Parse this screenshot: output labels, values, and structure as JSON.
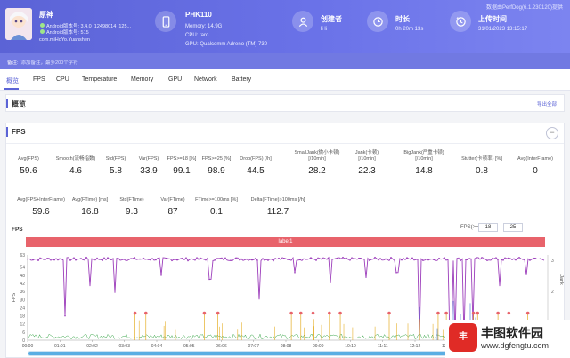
{
  "header": {
    "note": "数据由PerfDog(6.1.230120)提供",
    "app": {
      "name": "原神",
      "android_version": "Android版本号: 3.4.0_12498014_125...",
      "android_build": "Android版本号: 515",
      "package": "com.miHoYo.Yuanshen"
    },
    "device": {
      "name": "PHK110",
      "memory": "Memory: 14.9G",
      "cpu": "CPU: taro",
      "gpu": "GPU: Qualcomm Adreno (TM) 730"
    },
    "creator": {
      "label": "创建者",
      "value": "li li"
    },
    "duration": {
      "label": "时长",
      "value": "0h 20m 13s"
    },
    "upload": {
      "label": "上传时间",
      "value": "31/01/2023 13:15:17"
    }
  },
  "subbar": {
    "label": "备注:",
    "placeholder": "添加备注，最多200个字符"
  },
  "tabs": [
    "概览",
    "FPS",
    "CPU",
    "Temperature",
    "Memory",
    "GPU",
    "Network",
    "Battery"
  ],
  "overview": {
    "title": "概览",
    "export": "导出全部"
  },
  "fps": {
    "title": "FPS",
    "collapse": "−",
    "metrics_row1": [
      {
        "label": "Avg(FPS)",
        "value": "59.6"
      },
      {
        "label": "Smooth(流畅指数)",
        "value": "4.6"
      },
      {
        "label": "Std(FPS)",
        "value": "5.8"
      },
      {
        "label": "Var(FPS)",
        "value": "33.9"
      },
      {
        "label": "FPS>=18 [%]",
        "value": "99.1"
      },
      {
        "label": "FPS>=25 [%]",
        "value": "98.9"
      },
      {
        "label": "Drop(FPS) [/h]",
        "value": "44.5"
      },
      {
        "label": "SmallJank(微小卡顿)\n[/10min]",
        "value": "28.2"
      },
      {
        "label": "Jank(卡顿)\n[/10min]",
        "value": "22.3"
      },
      {
        "label": "BigJank(严重卡顿)\n[/10min]",
        "value": "14.8"
      },
      {
        "label": "Stutter(卡顿率) [%]",
        "value": "0.8"
      },
      {
        "label": "Avg(InterFrame)",
        "value": "0"
      }
    ],
    "metrics_row2": [
      {
        "label": "Avg(FPS+InterFrame)",
        "value": "59.6"
      },
      {
        "label": "Avg(FTime) [ms]",
        "value": "16.8"
      },
      {
        "label": "Std(FTime)",
        "value": "9.3"
      },
      {
        "label": "Var(FTime)",
        "value": "87"
      },
      {
        "label": "FTime>=100ms [%]",
        "value": "0.1"
      },
      {
        "label": "Delta(FTime)>100ms [/h]",
        "value": "112.7"
      }
    ],
    "chart_title": "FPS",
    "threshold_label": "FPS(>=)",
    "threshold_values": [
      "18",
      "25"
    ],
    "band_label": "label1"
  },
  "chart_data": {
    "type": "line",
    "ylabel": "FPS",
    "y2label": "Jank",
    "yticks": [
      0,
      6,
      12,
      18,
      24,
      30,
      36,
      42,
      48,
      54,
      63
    ],
    "y2ticks": [
      1,
      2,
      3
    ],
    "xticks": [
      "00:00",
      "01:01",
      "02:02",
      "03:03",
      "04:04",
      "05:05",
      "06:06",
      "07:07",
      "08:08",
      "09:09",
      "10:10",
      "11:11",
      "12:12",
      "13:13",
      "14:14",
      "15:15",
      "16:1"
    ],
    "series": [
      {
        "name": "FPS",
        "color": "#9c3dbb",
        "baseline": 60
      }
    ],
    "jank_markers": [
      {
        "t": 3.95,
        "type": "BigJank"
      },
      {
        "t": 4.35,
        "type": "BigJank"
      },
      {
        "t": 6.5,
        "type": "BigJank"
      },
      {
        "t": 7.0,
        "type": "BigJank"
      },
      {
        "t": 9.7,
        "type": "BigJank"
      },
      {
        "t": 10.05,
        "type": "BigJank"
      },
      {
        "t": 10.5,
        "type": "BigJank"
      },
      {
        "t": 11.1,
        "type": "BigJank"
      },
      {
        "t": 11.5,
        "type": "BigJank"
      },
      {
        "t": 13.3,
        "type": "BigJank"
      },
      {
        "t": 15.1,
        "type": "BigJank"
      },
      {
        "t": 15.4,
        "type": "BigJank"
      },
      {
        "t": 16.4,
        "type": "BigJank"
      },
      {
        "t": 16.55,
        "type": "BigJank"
      },
      {
        "t": 17.3,
        "type": "BigJank"
      },
      {
        "t": 17.7,
        "type": "BigJank"
      },
      {
        "t": 18.4,
        "type": "BigJank"
      }
    ],
    "colors": {
      "fps": "#9c3dbb",
      "jank": "#e0a000",
      "bigjank": "#e8636b",
      "ftime": "#3aa64a",
      "interframe": "#3b6fd6"
    }
  }
}
